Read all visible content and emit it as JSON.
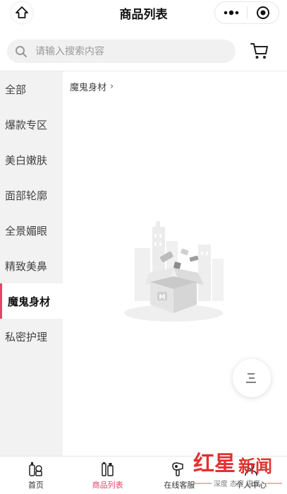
{
  "header": {
    "title": "商品列表"
  },
  "search": {
    "placeholder": "请输入搜索内容"
  },
  "sidebar": {
    "items": [
      {
        "label": "全部"
      },
      {
        "label": "爆款专区"
      },
      {
        "label": "美白嫩肤"
      },
      {
        "label": "面部轮廓"
      },
      {
        "label": "全景媚眼"
      },
      {
        "label": "精致美鼻"
      },
      {
        "label": "魔鬼身材",
        "active": true
      },
      {
        "label": "私密护理"
      }
    ]
  },
  "main": {
    "breadcrumb": "魔鬼身材"
  },
  "tabbar": {
    "tabs": [
      {
        "label": "首页",
        "icon": "home-bottles-icon"
      },
      {
        "label": "商品列表",
        "icon": "product-list-icon",
        "active": true
      },
      {
        "label": "在线客服",
        "icon": "hair-dryer-icon"
      },
      {
        "label": "个人中心",
        "icon": "user-center-icon"
      }
    ]
  },
  "colors": {
    "accent": "#e5456a",
    "sidebar_bg": "#f2f2f2"
  },
  "watermark": {
    "brand": "红星新闻",
    "caption": "深度 态度 温度"
  }
}
